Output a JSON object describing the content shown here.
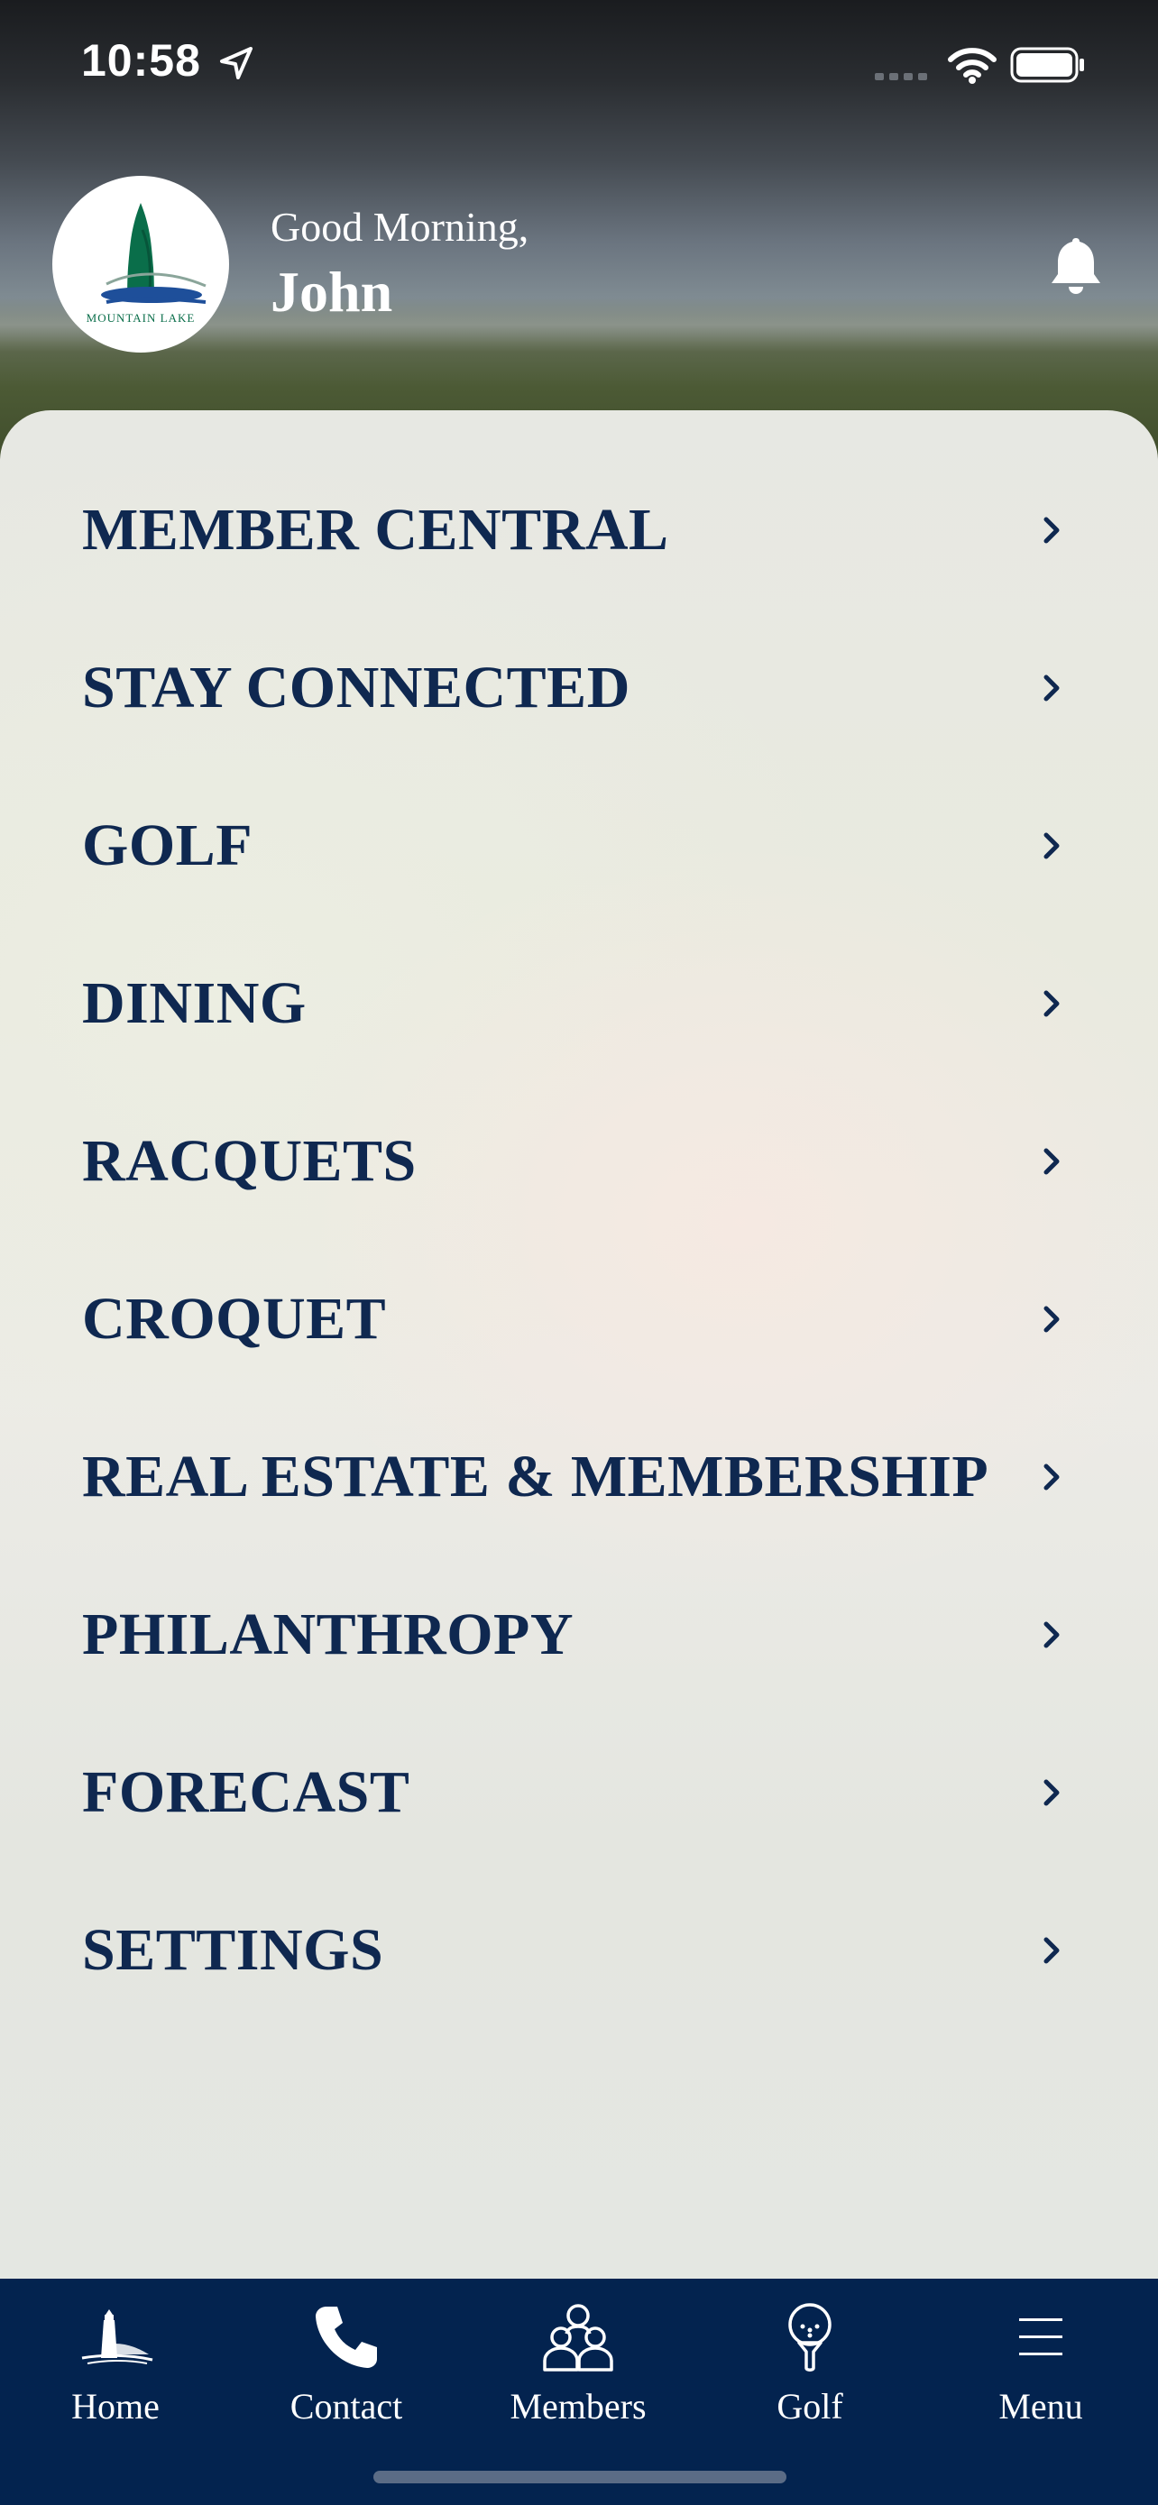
{
  "status_bar": {
    "time": "10:58"
  },
  "header": {
    "logo_text": "MOUNTAIN LAKE",
    "greeting": "Good Morning,",
    "user_name": "John"
  },
  "menu": {
    "items": [
      {
        "label": "MEMBER CENTRAL"
      },
      {
        "label": "STAY CONNECTED"
      },
      {
        "label": "GOLF"
      },
      {
        "label": "DINING"
      },
      {
        "label": "RACQUETS"
      },
      {
        "label": "CROQUET"
      },
      {
        "label": "REAL ESTATE & MEMBERSHIP"
      },
      {
        "label": "PHILANTHROPY"
      },
      {
        "label": "FORECAST"
      },
      {
        "label": "SETTINGS"
      }
    ]
  },
  "tabbar": {
    "tabs": [
      {
        "label": "Home",
        "icon": "lighthouse-icon"
      },
      {
        "label": "Contact",
        "icon": "phone-icon"
      },
      {
        "label": "Members",
        "icon": "members-icon"
      },
      {
        "label": "Golf",
        "icon": "golf-ball-tee-icon"
      },
      {
        "label": "Menu",
        "icon": "hamburger-menu-icon"
      }
    ]
  },
  "colors": {
    "brand_navy": "#03234f",
    "menu_text": "#0f2850",
    "logo_green": "#0a6e4a",
    "logo_blue": "#1e4f9a"
  }
}
